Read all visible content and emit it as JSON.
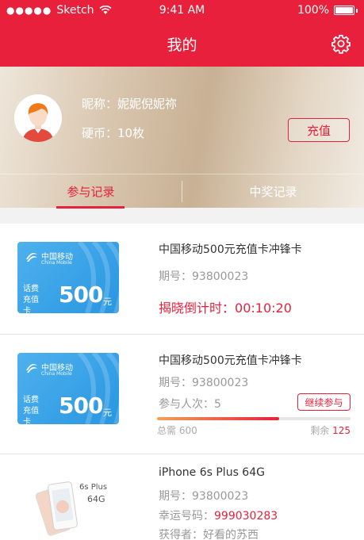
{
  "statusbar": {
    "carrier": "Sketch",
    "time": "9:41 AM",
    "battery": "100%"
  },
  "navbar": {
    "title": "我的"
  },
  "profile": {
    "nickname_label": "昵称：",
    "nickname": "妮妮倪妮祢",
    "coins_label": "硬币：",
    "coins": "10枚",
    "recharge_label": "充值"
  },
  "tabs": [
    {
      "label": "参与记录",
      "active": true
    },
    {
      "label": "中奖记录",
      "active": false
    }
  ],
  "items": [
    {
      "card": {
        "brand": "中国移动",
        "brand_en": "China Mobile",
        "type": "话费充值卡",
        "amount": "500",
        "unit": "元"
      },
      "title": "中国移动500元充值卡冲锋卡",
      "period_label": "期号：",
      "period": "93800023",
      "countdown_label": "揭晓倒计时：",
      "countdown": "00:10:20"
    },
    {
      "card": {
        "brand": "中国移动",
        "brand_en": "China Mobile",
        "type": "话费充值卡",
        "amount": "500",
        "unit": "元"
      },
      "title": "中国移动500元充值卡冲锋卡",
      "period_label": "期号：",
      "period": "93800023",
      "times_label": "参与人次：",
      "times": "5",
      "continue_label": "继续参与",
      "progress": 0.63,
      "total_label": "总需",
      "total": "600",
      "remaining_label": "剩余",
      "remaining": "125"
    },
    {
      "phone_label_top": "6s Plus",
      "phone_label_bottom": "64G",
      "title": "iPhone 6s Plus 64G",
      "period_label": "期号：",
      "period": "93800023",
      "lucky_label": "幸运号码：",
      "lucky": "999030283",
      "winner_label": "获得者：",
      "winner": "好看的苏西"
    }
  ],
  "colors": {
    "brand_red": "#e8203b",
    "card_blue": "#3aa3e8"
  }
}
